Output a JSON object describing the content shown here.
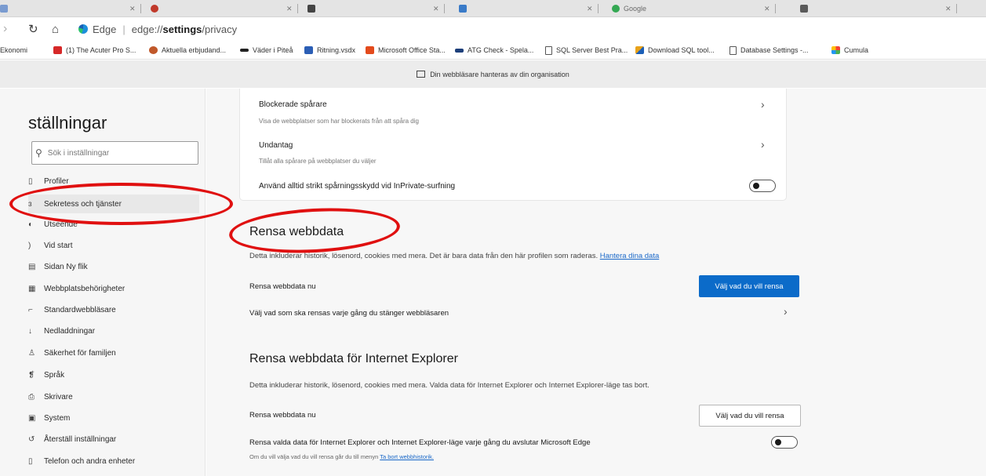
{
  "tabs": [
    {
      "label": "",
      "color": "#7a9bd0"
    },
    {
      "label": "",
      "color": "#c0392b"
    },
    {
      "label": "",
      "color": "#444444"
    },
    {
      "label": "",
      "color": "#3a7bc8"
    },
    {
      "label": "Google",
      "color": "#34a853"
    },
    {
      "label": "",
      "color": "#5a5a5a"
    }
  ],
  "address_bar": {
    "back_icon": "refresh-icon",
    "home_icon": "home-icon",
    "browser_label": "Edge",
    "url_scheme": "edge://",
    "url_bold": "settings",
    "url_rest": "/privacy"
  },
  "favorites": [
    {
      "label": "Ekonomi",
      "icon_color": "#ffffff"
    },
    {
      "label": "(1) The Acuter Pro S...",
      "icon_color": "#d62828"
    },
    {
      "label": "Aktuella erbjudand...",
      "icon_color": "#c0582a"
    },
    {
      "label": "Väder i Piteå",
      "icon_color": "#222222"
    },
    {
      "label": "Ritning.vsdx",
      "icon_color": "#2b5eb5"
    },
    {
      "label": "Microsoft Office Sta...",
      "icon_color": "#e34a1c"
    },
    {
      "label": "ATG Check - Spela...",
      "icon_color": "#1d3f7a"
    },
    {
      "label": "SQL Server Best Pra...",
      "icon_color": "#ffffff"
    },
    {
      "label": "Download SQL tool...",
      "icon_color": "#e8a21a"
    },
    {
      "label": "Database Settings -...",
      "icon_color": "#ffffff"
    },
    {
      "label": "Cumula",
      "icon_color": "#4caf50"
    }
  ],
  "managed_notice": "Din webbläsare hanteras av din organisation",
  "sidebar": {
    "title": "ställningar",
    "search_placeholder": "Sök i inställningar",
    "items": [
      {
        "label": "Profiler",
        "icon": "profile-icon"
      },
      {
        "label": "Sekretess och tjänster",
        "icon": "lock-icon"
      },
      {
        "label": "Utseende",
        "icon": "appearance-icon"
      },
      {
        "label": "Vid start",
        "icon": "power-icon"
      },
      {
        "label": "Sidan Ny flik",
        "icon": "newtab-icon"
      },
      {
        "label": "Webbplatsbehörigheter",
        "icon": "site-permissions-icon"
      },
      {
        "label": "Standardwebbläsare",
        "icon": "default-browser-icon"
      },
      {
        "label": "Nedladdningar",
        "icon": "download-icon"
      },
      {
        "label": "Säkerhet för familjen",
        "icon": "family-icon"
      },
      {
        "label": "Språk",
        "icon": "language-icon"
      },
      {
        "label": "Skrivare",
        "icon": "printer-icon"
      },
      {
        "label": "System",
        "icon": "system-icon"
      },
      {
        "label": "Återställ inställningar",
        "icon": "reset-icon"
      },
      {
        "label": "Telefon och andra enheter",
        "icon": "phone-icon"
      }
    ]
  },
  "tracking_card": {
    "blocked": {
      "title": "Blockerade spårare",
      "desc": "Visa de webbplatser som har blockerats från att spåra dig"
    },
    "exceptions": {
      "title": "Undantag",
      "desc": "Tillåt alla spårare på webbplatser du väljer"
    },
    "strict_inprivate": {
      "title": "Använd alltid strikt spårningsskydd vid InPrivate-surfning"
    }
  },
  "clear_data": {
    "title": "Rensa webbdata",
    "desc": "Detta inkluderar historik, lösenord, cookies med mera. Det är bara data från den här profilen som raderas.",
    "link": "Hantera dina data",
    "clear_now_label": "Rensa webbdata nu",
    "clear_now_button": "Välj vad du vill rensa",
    "on_close_label": "Välj vad som ska rensas varje gång du stänger webbläsaren"
  },
  "clear_ie": {
    "title": "Rensa webbdata för Internet Explorer",
    "desc": "Detta inkluderar historik, lösenord, cookies med mera. Valda data för Internet Explorer och Internet Explorer-läge tas bort.",
    "clear_now_label": "Rensa webbdata nu",
    "clear_now_button": "Välj vad du vill rensa",
    "on_exit_label": "Rensa valda data för Internet Explorer och Internet Explorer-läge varje gång du avslutar Microsoft Edge",
    "on_exit_desc": "Om du vill välja vad du vill rensa går du till menyn",
    "on_exit_link": "Ta bort webbhistorik."
  },
  "colors": {
    "primary_button": "#0b6bc9",
    "link": "#1a68c8",
    "annotation": "#e01010"
  }
}
